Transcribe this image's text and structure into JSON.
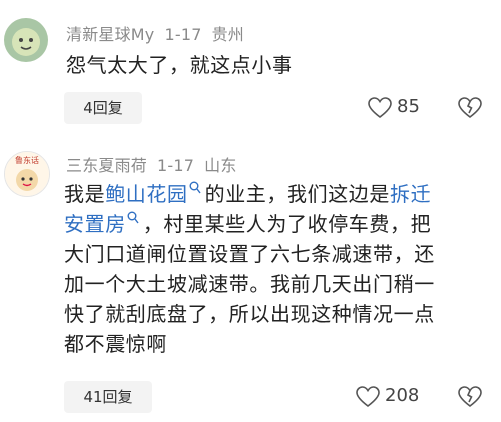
{
  "comments": [
    {
      "username": "清新星球My",
      "date": "1-17",
      "location": "贵州",
      "text": "怨气太大了，就这点小事",
      "replies": "4回复",
      "likes": "85"
    },
    {
      "username": "三东夏雨荷",
      "date": "1-17",
      "location": "山东",
      "avatar_text": "鲁东话",
      "lines": [
        [
          "我是",
          "鲍山花园",
          "的业主，我们这边是",
          "拆迁"
        ],
        [
          "安置房",
          "，村里某些人为了收停车费，把"
        ],
        [
          "大门口道闸位置设置了六七条减速带，还"
        ],
        [
          "加一个大土坡减速带。我前几天出门稍一"
        ],
        [
          "快了就刮底盘了，所以出现这种情况一点"
        ],
        [
          "都不震惊啊"
        ]
      ],
      "replies": "41回复",
      "likes": "208"
    }
  ]
}
